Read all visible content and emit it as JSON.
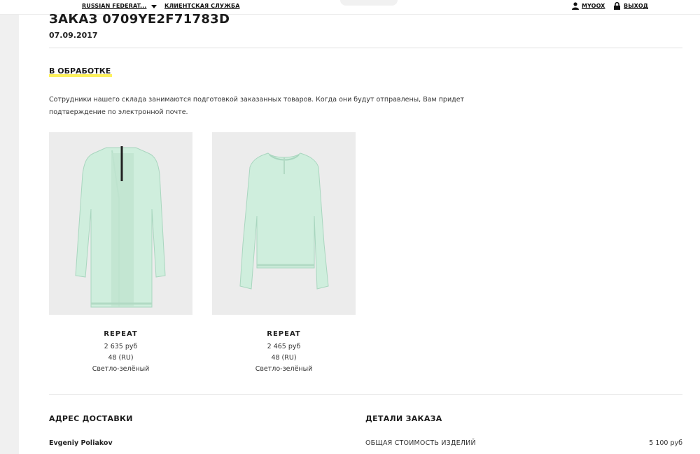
{
  "header": {
    "country": "RUSSIAN FEDERAT...",
    "customer_service": "КЛИЕНТСКАЯ СЛУЖБА",
    "myoox": "MYOOX",
    "logout": "ВЫХОД"
  },
  "order": {
    "title": "ЗАКАЗ 0709YE2F71783D",
    "date": "07.09.2017",
    "status": "В ОБРАБОТКЕ",
    "description": "Сотрудники нашего склада занимаются подготовкой заказанных товаров. Когда они будут отправлены, Вам придет подтверждение по электронной почте.",
    "status_highlight_color": "#fdf15c"
  },
  "products": [
    {
      "brand": "REPEAT",
      "price": "2 635 руб",
      "size": "48 (RU)",
      "color": "Светло-зелёный",
      "image_icon": "mint-cardigan-image"
    },
    {
      "brand": "REPEAT",
      "price": "2 465 руб",
      "size": "48 (RU)",
      "color": "Светло-зелёный",
      "image_icon": "mint-sweater-image"
    }
  ],
  "shipping": {
    "heading": "АДРЕС ДОСТАВКИ",
    "name": "Evgeniy Poliakov"
  },
  "details": {
    "heading": "ДЕТАЛИ ЗАКАЗА",
    "total_label": "ОБЩАЯ СТОИМОСТЬ ИЗДЕЛИЙ",
    "total_value": "5 100 руб"
  }
}
